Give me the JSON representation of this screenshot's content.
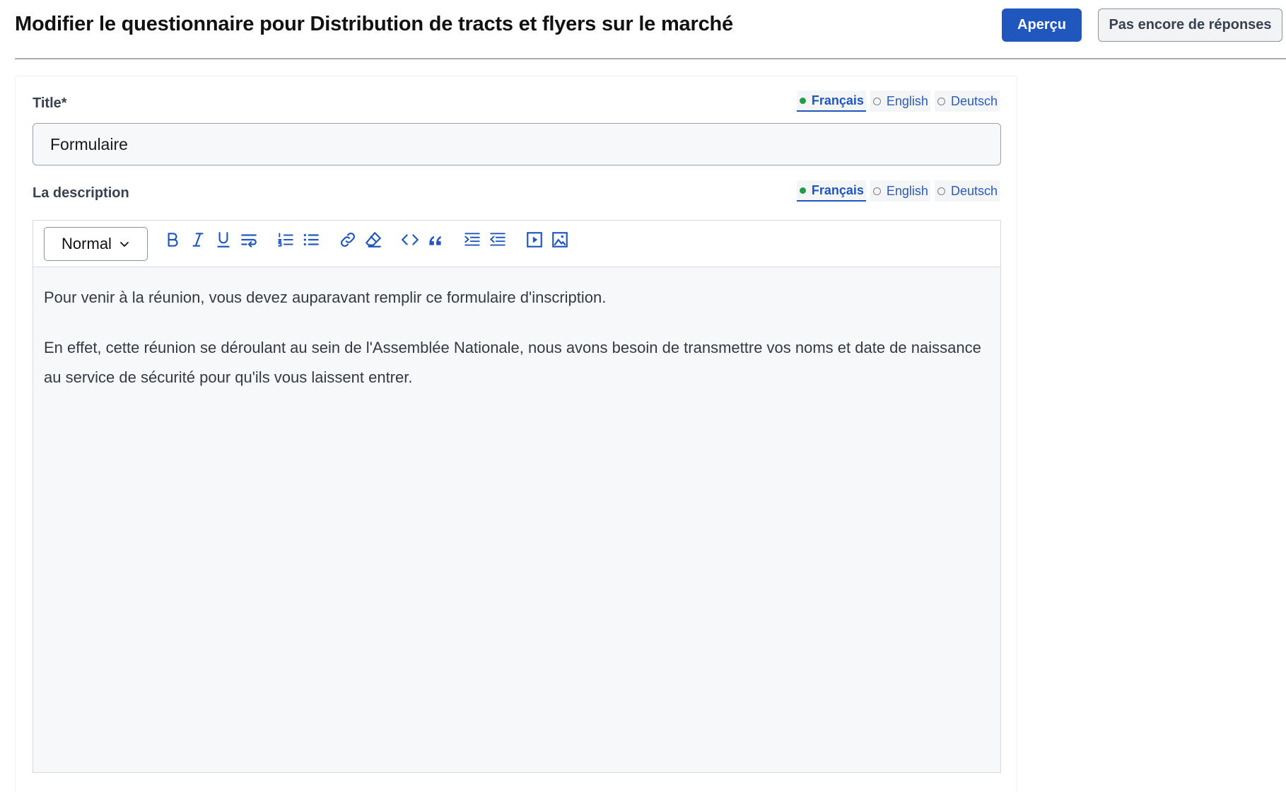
{
  "header": {
    "title": "Modifier le questionnaire pour Distribution de tracts et flyers sur le marché",
    "preview_label": "Aperçu",
    "responses_label": "Pas encore de réponses"
  },
  "title_field": {
    "label": "Title*",
    "value": "Formulaire",
    "languages": [
      {
        "label": "Français",
        "active": true
      },
      {
        "label": "English",
        "active": false
      },
      {
        "label": "Deutsch",
        "active": false
      }
    ]
  },
  "description_field": {
    "label": "La description",
    "languages": [
      {
        "label": "Français",
        "active": true
      },
      {
        "label": "English",
        "active": false
      },
      {
        "label": "Deutsch",
        "active": false
      }
    ],
    "toolbar": {
      "format_value": "Normal",
      "icons": [
        "bold-icon",
        "italic-icon",
        "underline-icon",
        "text-wrap-icon",
        "ordered-list-icon",
        "bullet-list-icon",
        "link-icon",
        "clear-format-icon",
        "code-icon",
        "quote-icon",
        "indent-icon",
        "outdent-icon",
        "video-icon",
        "image-icon"
      ]
    },
    "paragraphs": [
      "Pour venir à la réunion, vous devez auparavant remplir ce formulaire d'inscription.",
      "En effet, cette réunion se déroulant au sein de l'Assemblée Nationale, nous avons besoin de transmettre vos noms et date de naissance au service de sécurité pour qu'ils vous laissent entrer."
    ]
  },
  "colors": {
    "primary": "#2057bf",
    "active_dot": "#1e9e49",
    "icon": "#2057bf"
  }
}
